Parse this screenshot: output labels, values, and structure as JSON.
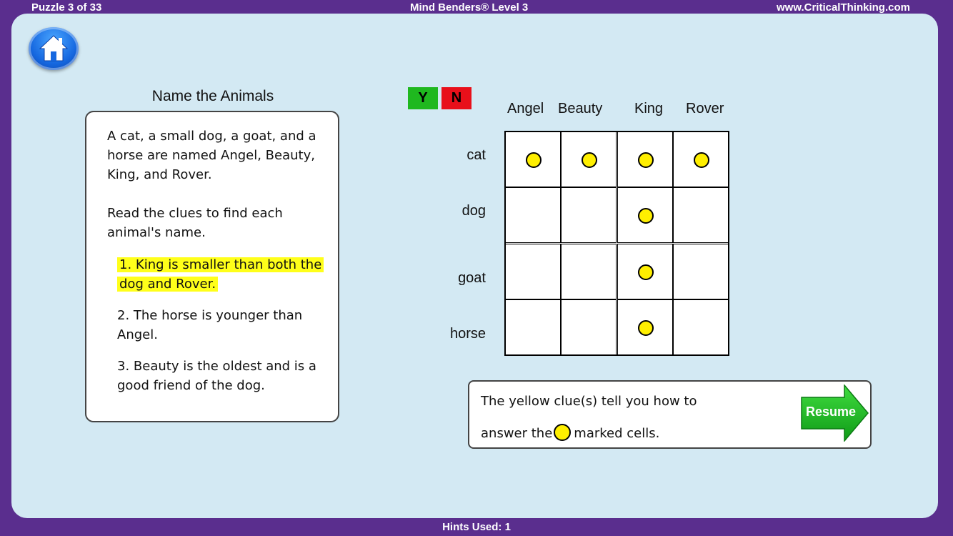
{
  "header": {
    "puzzle_counter": "Puzzle 3 of 33",
    "app_title": "Mind Benders® Level 3",
    "website": "www.CriticalThinking.com"
  },
  "footer": {
    "hints_used": "Hints Used: 1"
  },
  "home_button": {
    "icon": "home-icon"
  },
  "puzzle": {
    "title": "Name the Animals",
    "intro": "A cat, a small dog, a goat, and a horse are named Angel, Beauty, King, and Rover.",
    "instructions": "Read the clues to find each animal's name.",
    "clues": [
      {
        "text": "1. King is smaller than both the dog and Rover.",
        "highlighted": true
      },
      {
        "text": "2. The horse is younger than Angel.",
        "highlighted": false
      },
      {
        "text": "3. Beauty is the oldest and is a good friend of the dog.",
        "highlighted": false
      }
    ]
  },
  "toggles": {
    "yes": "Y",
    "no": "N",
    "yes_color": "#1fb81f",
    "no_color": "#e8101a"
  },
  "grid": {
    "columns": [
      "Angel",
      "Beauty",
      "King",
      "Rover"
    ],
    "rows": [
      "cat",
      "dog",
      "goat",
      "horse"
    ],
    "marks": [
      [
        true,
        true,
        true,
        true
      ],
      [
        false,
        false,
        true,
        false
      ],
      [
        false,
        false,
        true,
        false
      ],
      [
        false,
        false,
        true,
        false
      ]
    ]
  },
  "hint": {
    "line1": "The yellow clue(s) tell you how to",
    "line2_before": "answer the",
    "line2_after": "marked cells."
  },
  "resume_button": {
    "label": "Resume"
  },
  "colors": {
    "background": "#5a2e8e",
    "panel": "#d3e9f3",
    "highlight": "#ffff1a",
    "mark": "#ffef00"
  }
}
